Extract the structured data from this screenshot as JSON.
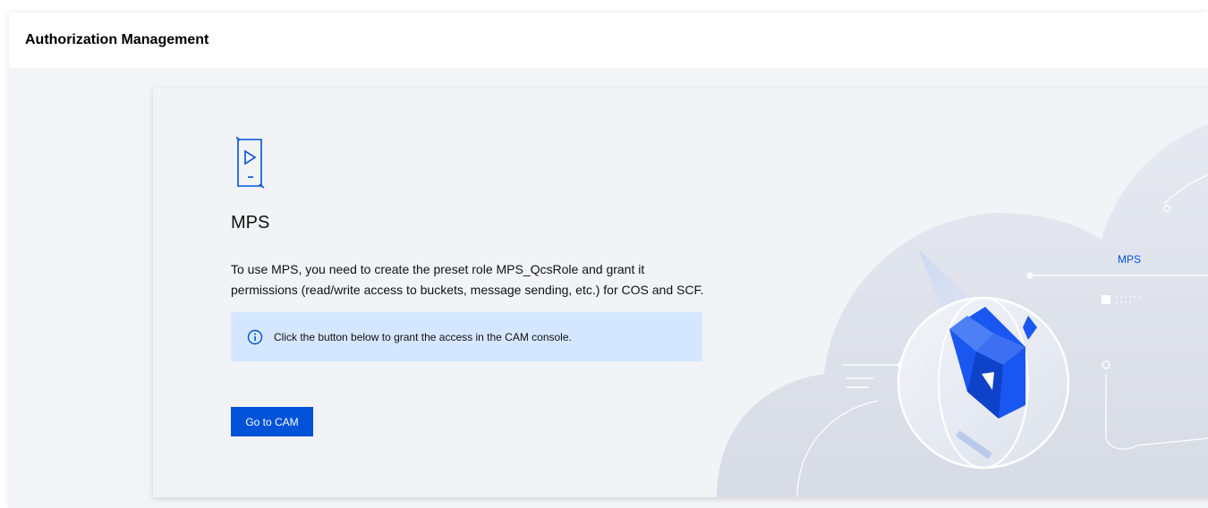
{
  "header": {
    "title": "Authorization Management"
  },
  "card": {
    "product_icon": "mps-video-icon",
    "product_name": "MPS",
    "description": "To use MPS, you need to create the preset role MPS_QcsRole and grant it permissions (read/write access to buckets, message sending, etc.) for COS and SCF.",
    "notice": {
      "icon": "info-circle-icon",
      "text": "Click the button below to grant the access in the CAM console."
    },
    "button_label": "Go to CAM"
  },
  "illustration": {
    "label": "MPS"
  },
  "colors": {
    "accent": "#0052d9",
    "notice_bg": "#d5e7ff",
    "page_bg": "#f3f4f7"
  }
}
